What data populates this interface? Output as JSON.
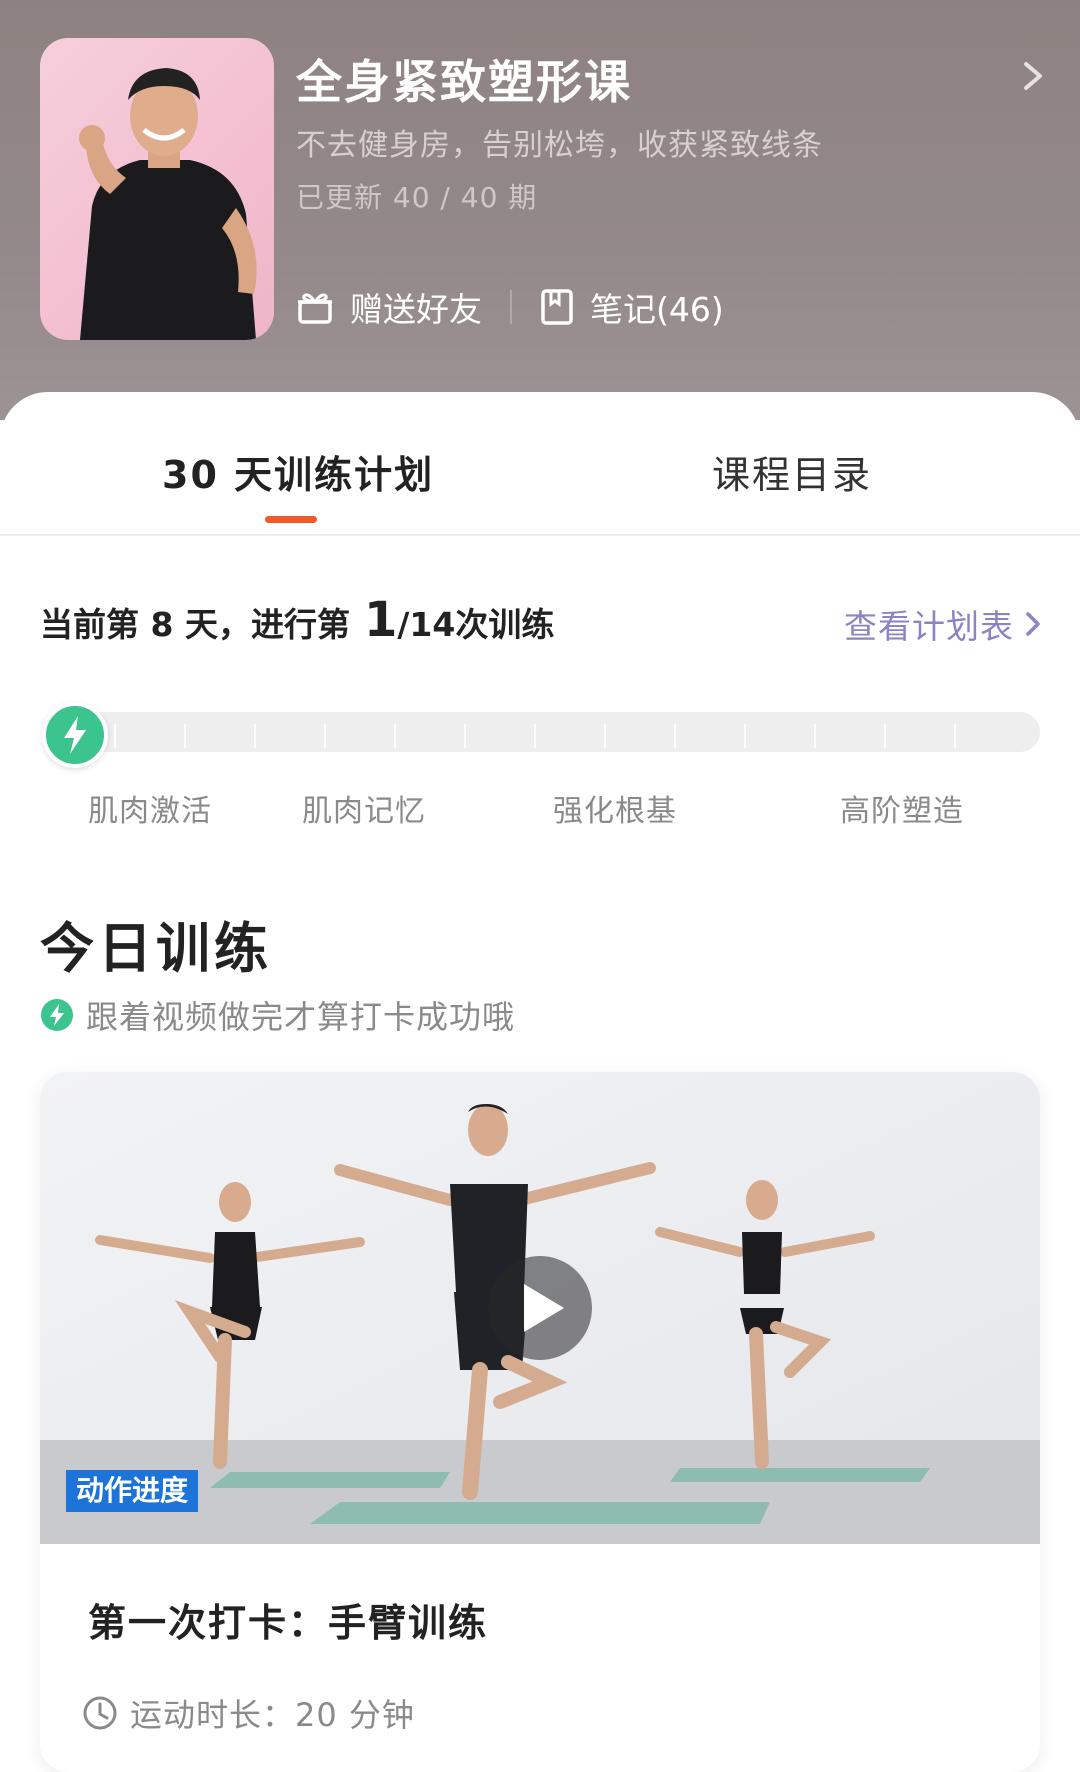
{
  "course": {
    "title": "全身紧致塑形课",
    "subtitle": "不去健身房，告别松垮，收获紧致线条",
    "updated": "已更新 40 / 40 期",
    "gift_label": "赠送好友",
    "notes_label": "笔记(46)"
  },
  "tabs": [
    {
      "label": "30 天训练计划",
      "active": true
    },
    {
      "label": "课程目录",
      "active": false
    }
  ],
  "progress": {
    "prefix": "当前第 8 天，进行第 ",
    "current": "1",
    "total": "/14",
    "suffix": " 次训练",
    "plan_link": "查看计划表",
    "fraction": 0.0
  },
  "stages": [
    "肌肉激活",
    "肌肉记忆",
    "强化根基",
    "高阶塑造"
  ],
  "today": {
    "title": "今日训练",
    "tip": "跟着视频做完才算打卡成功哦",
    "video_overlay": "动作进度",
    "lesson_title": "第一次打卡：手臂训练",
    "duration": "运动时长：20 分钟"
  },
  "colors": {
    "accent_orange": "#f05a28",
    "accent_green": "#3cc48f",
    "link_purple": "#8a84c4"
  }
}
